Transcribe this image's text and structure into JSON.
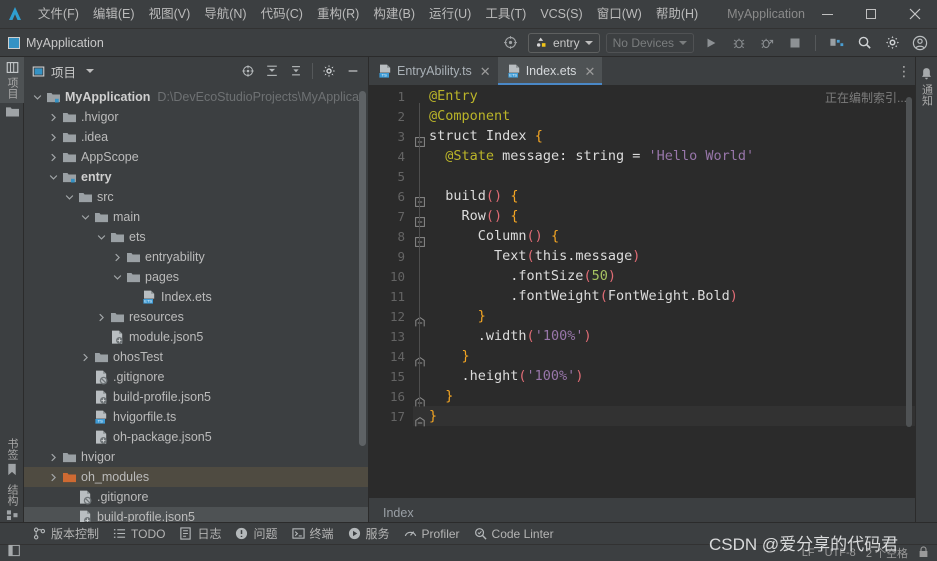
{
  "window": {
    "title": "MyApplication",
    "minimize_label": "最小化",
    "maximize_label": "最大化",
    "close_label": "关闭"
  },
  "menubar": {
    "items": [
      {
        "label": "文件(F)"
      },
      {
        "label": "编辑(E)"
      },
      {
        "label": "视图(V)"
      },
      {
        "label": "导航(N)"
      },
      {
        "label": "代码(C)"
      },
      {
        "label": "重构(R)"
      },
      {
        "label": "构建(B)"
      },
      {
        "label": "运行(U)"
      },
      {
        "label": "工具(T)"
      },
      {
        "label": "VCS(S)"
      },
      {
        "label": "窗口(W)"
      },
      {
        "label": "帮助(H)"
      }
    ]
  },
  "navbar": {
    "project_label": "MyApplication",
    "run_config": "entry",
    "device_selector": "No Devices",
    "buttons": [
      {
        "name": "run-button",
        "label": "运行"
      },
      {
        "name": "debug-button",
        "label": "调试"
      },
      {
        "name": "profile-button",
        "label": "性能分析"
      },
      {
        "name": "stop-button",
        "label": "停止"
      },
      {
        "name": "device-manager-button",
        "label": "设备管理器"
      },
      {
        "name": "search-everywhere-button",
        "label": "搜索"
      },
      {
        "name": "settings-button",
        "label": "设置"
      },
      {
        "name": "account-button",
        "label": "账户"
      }
    ]
  },
  "left_stripe": {
    "top": [
      {
        "label": "项目",
        "icon": "project-icon",
        "active": true
      },
      {
        "label": "",
        "icon": "folder-icon",
        "active": false
      }
    ],
    "bottom": [
      {
        "label": "书签",
        "icon": "bookmark-icon"
      },
      {
        "label": "结构",
        "icon": "structure-icon"
      }
    ]
  },
  "right_stripe": {
    "items": [
      {
        "label": "通知",
        "icon": "bell-icon"
      }
    ]
  },
  "project_panel": {
    "title": "项目",
    "toolbar": [
      {
        "name": "select-opened-file-icon",
        "label": "定位"
      },
      {
        "name": "expand-all-icon",
        "label": "全部展开"
      },
      {
        "name": "collapse-all-icon",
        "label": "全部折叠"
      },
      {
        "name": "settings-gear-icon",
        "label": "选项"
      },
      {
        "name": "hide-panel-icon",
        "label": "隐藏"
      }
    ],
    "tree": [
      {
        "indent": 0,
        "arrow": "down",
        "icon": "module-icon",
        "label": "MyApplication",
        "bold": true,
        "path": "D:\\DevEcoStudioProjects\\MyApplicat",
        "state": "none"
      },
      {
        "indent": 1,
        "arrow": "right",
        "icon": "folder-icon",
        "label": ".hvigor",
        "state": "none"
      },
      {
        "indent": 1,
        "arrow": "right",
        "icon": "folder-icon",
        "label": ".idea",
        "state": "none"
      },
      {
        "indent": 1,
        "arrow": "right",
        "icon": "folder-icon",
        "label": "AppScope",
        "state": "none"
      },
      {
        "indent": 1,
        "arrow": "down",
        "icon": "module-icon",
        "label": "entry",
        "bold": true,
        "state": "none"
      },
      {
        "indent": 2,
        "arrow": "down",
        "icon": "folder-icon",
        "label": "src",
        "state": "none"
      },
      {
        "indent": 3,
        "arrow": "down",
        "icon": "folder-icon",
        "label": "main",
        "state": "none"
      },
      {
        "indent": 4,
        "arrow": "down",
        "icon": "folder-icon",
        "label": "ets",
        "state": "none"
      },
      {
        "indent": 5,
        "arrow": "right",
        "icon": "folder-icon",
        "label": "entryability",
        "state": "none"
      },
      {
        "indent": 5,
        "arrow": "down",
        "icon": "folder-icon",
        "label": "pages",
        "state": "none"
      },
      {
        "indent": 6,
        "arrow": "none",
        "icon": "ets-file-icon",
        "label": "Index.ets",
        "state": "none"
      },
      {
        "indent": 4,
        "arrow": "right",
        "icon": "folder-icon",
        "label": "resources",
        "state": "none"
      },
      {
        "indent": 4,
        "arrow": "none",
        "icon": "json5-file-icon",
        "label": "module.json5",
        "state": "none"
      },
      {
        "indent": 3,
        "arrow": "right",
        "icon": "folder-icon",
        "label": "ohosTest",
        "state": "none"
      },
      {
        "indent": 3,
        "arrow": "none",
        "icon": "gitignore-file-icon",
        "label": ".gitignore",
        "state": "none"
      },
      {
        "indent": 3,
        "arrow": "none",
        "icon": "json5-file-icon",
        "label": "build-profile.json5",
        "state": "none"
      },
      {
        "indent": 3,
        "arrow": "none",
        "icon": "ts-file-icon",
        "label": "hvigorfile.ts",
        "state": "none"
      },
      {
        "indent": 3,
        "arrow": "none",
        "icon": "json5-file-icon",
        "label": "oh-package.json5",
        "state": "none"
      },
      {
        "indent": 1,
        "arrow": "right",
        "icon": "folder-icon",
        "label": "hvigor",
        "state": "none"
      },
      {
        "indent": 1,
        "arrow": "right",
        "icon": "folder-orange-icon",
        "label": "oh_modules",
        "state": "selected"
      },
      {
        "indent": 2,
        "arrow": "none",
        "icon": "gitignore-file-icon",
        "label": ".gitignore",
        "state": "none"
      },
      {
        "indent": 2,
        "arrow": "none",
        "icon": "json5-file-icon",
        "label": "build-profile.json5",
        "state": "hover"
      }
    ]
  },
  "editor": {
    "tabs": [
      {
        "label": "EntryAbility.ts",
        "icon": "ts-file-icon",
        "active": false,
        "close": "✕"
      },
      {
        "label": "Index.ets",
        "icon": "ets-file-icon",
        "active": true,
        "close": "✕"
      }
    ],
    "more_tabs_icon": "⋮",
    "status_text": "正在编制索引...",
    "breadcrumb": "Index",
    "current_line": 17,
    "line_numbers": [
      1,
      2,
      3,
      4,
      5,
      6,
      7,
      8,
      9,
      10,
      11,
      12,
      13,
      14,
      15,
      16,
      17
    ],
    "code_lines": [
      {
        "n": 1,
        "fold": "none",
        "tokens": [
          {
            "t": "@Entry",
            "c": "t-dec"
          }
        ]
      },
      {
        "n": 2,
        "fold": "none",
        "tokens": [
          {
            "t": "@Component",
            "c": "t-dec"
          }
        ]
      },
      {
        "n": 3,
        "fold": "start",
        "tokens": [
          {
            "t": "struct ",
            "c": "t-white"
          },
          {
            "t": "Index",
            "c": "t-white"
          },
          {
            "t": " ",
            "c": "t-white"
          },
          {
            "t": "{",
            "c": "t-brc"
          }
        ]
      },
      {
        "n": 4,
        "fold": "none",
        "tokens": [
          {
            "t": "  ",
            "c": "t-white"
          },
          {
            "t": "@State",
            "c": "t-dec"
          },
          {
            "t": " message: string = ",
            "c": "t-white"
          },
          {
            "t": "'Hello World'",
            "c": "t-str"
          }
        ]
      },
      {
        "n": 5,
        "fold": "none",
        "tokens": []
      },
      {
        "n": 6,
        "fold": "start",
        "tokens": [
          {
            "t": "  build",
            "c": "t-white"
          },
          {
            "t": "()",
            "c": "t-par"
          },
          {
            "t": " ",
            "c": "t-white"
          },
          {
            "t": "{",
            "c": "t-brc"
          }
        ]
      },
      {
        "n": 7,
        "fold": "start",
        "tokens": [
          {
            "t": "    Row",
            "c": "t-white"
          },
          {
            "t": "()",
            "c": "t-par"
          },
          {
            "t": " ",
            "c": "t-white"
          },
          {
            "t": "{",
            "c": "t-brc"
          }
        ]
      },
      {
        "n": 8,
        "fold": "start",
        "tokens": [
          {
            "t": "      Column",
            "c": "t-white"
          },
          {
            "t": "()",
            "c": "t-par"
          },
          {
            "t": " ",
            "c": "t-white"
          },
          {
            "t": "{",
            "c": "t-brc"
          }
        ]
      },
      {
        "n": 9,
        "fold": "none",
        "tokens": [
          {
            "t": "        Text",
            "c": "t-white"
          },
          {
            "t": "(",
            "c": "t-par"
          },
          {
            "t": "this.message",
            "c": "t-white"
          },
          {
            "t": ")",
            "c": "t-par"
          }
        ]
      },
      {
        "n": 10,
        "fold": "none",
        "tokens": [
          {
            "t": "          .fontSize",
            "c": "t-white"
          },
          {
            "t": "(",
            "c": "t-par"
          },
          {
            "t": "50",
            "c": "t-num"
          },
          {
            "t": ")",
            "c": "t-par"
          }
        ]
      },
      {
        "n": 11,
        "fold": "none",
        "tokens": [
          {
            "t": "          .fontWeight",
            "c": "t-white"
          },
          {
            "t": "(",
            "c": "t-par"
          },
          {
            "t": "FontWeight.Bold",
            "c": "t-white"
          },
          {
            "t": ")",
            "c": "t-par"
          }
        ]
      },
      {
        "n": 12,
        "fold": "end",
        "tokens": [
          {
            "t": "      ",
            "c": "t-white"
          },
          {
            "t": "}",
            "c": "t-brc"
          }
        ]
      },
      {
        "n": 13,
        "fold": "none",
        "tokens": [
          {
            "t": "      .width",
            "c": "t-white"
          },
          {
            "t": "(",
            "c": "t-par"
          },
          {
            "t": "'100%'",
            "c": "t-str"
          },
          {
            "t": ")",
            "c": "t-par"
          }
        ]
      },
      {
        "n": 14,
        "fold": "end",
        "tokens": [
          {
            "t": "    ",
            "c": "t-white"
          },
          {
            "t": "}",
            "c": "t-brc"
          }
        ]
      },
      {
        "n": 15,
        "fold": "none",
        "tokens": [
          {
            "t": "    .height",
            "c": "t-white"
          },
          {
            "t": "(",
            "c": "t-par"
          },
          {
            "t": "'100%'",
            "c": "t-str"
          },
          {
            "t": ")",
            "c": "t-par"
          }
        ]
      },
      {
        "n": 16,
        "fold": "end",
        "tokens": [
          {
            "t": "  ",
            "c": "t-white"
          },
          {
            "t": "}",
            "c": "t-brc"
          }
        ]
      },
      {
        "n": 17,
        "fold": "end",
        "tokens": [
          {
            "t": "}",
            "c": "t-brc"
          }
        ]
      }
    ]
  },
  "bottom_bar": {
    "items": [
      {
        "label": "版本控制",
        "icon": "vcs-icon"
      },
      {
        "label": "TODO",
        "icon": "todo-icon"
      },
      {
        "label": "日志",
        "icon": "log-icon"
      },
      {
        "label": "问题",
        "icon": "problems-icon"
      },
      {
        "label": "终端",
        "icon": "terminal-icon"
      },
      {
        "label": "服务",
        "icon": "services-icon"
      },
      {
        "label": "Profiler",
        "icon": "profiler-icon"
      },
      {
        "label": "Code Linter",
        "icon": "code-linter-icon"
      }
    ]
  },
  "status_bar": {
    "left_icon": "tool-window-toggle-icon",
    "line_separator": "LF",
    "encoding": "UTF-8",
    "indent": "2 个空格",
    "lock_icon": "lock-icon"
  },
  "watermark": {
    "text": "CSDN @爱分享的代码君"
  },
  "colors": {
    "accent_blue": "#4a88c7",
    "panel_bg": "#3c3f41",
    "editor_bg": "#2b2b2b",
    "selection_olive": "#4f4b41",
    "folder_orange": "#cf6a32"
  }
}
